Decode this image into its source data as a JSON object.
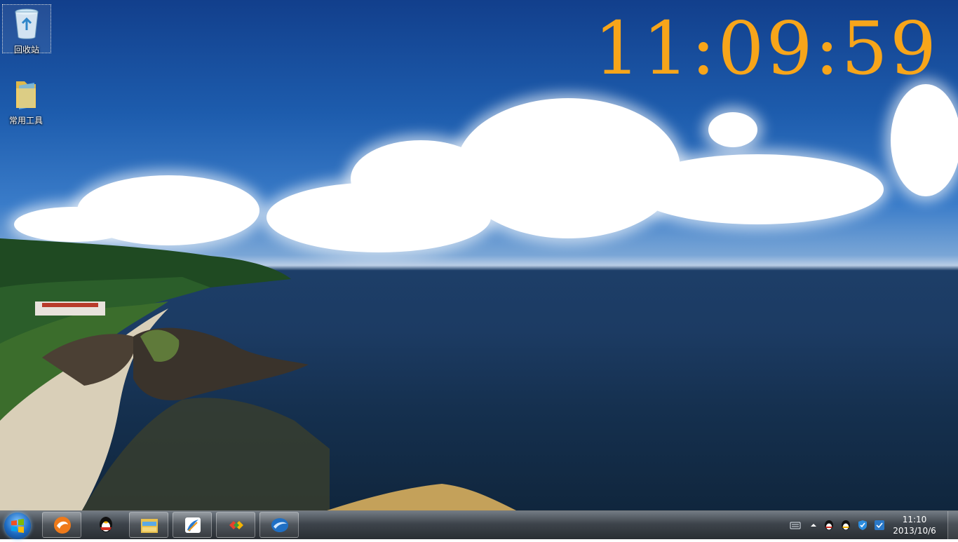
{
  "desktop": {
    "clock": "11:09:59",
    "icons": [
      {
        "label": "回收站",
        "icon": "recycle-bin-icon"
      },
      {
        "label": "常用工具",
        "icon": "folder-icon"
      }
    ]
  },
  "taskbar": {
    "start_icon": "windows-logo-icon",
    "pinned": [
      {
        "icon": "orange-browser-icon"
      },
      {
        "icon": "qq-penguin-icon"
      },
      {
        "icon": "file-explorer-icon"
      },
      {
        "icon": "blue-app-icon"
      },
      {
        "icon": "puzzle-app-icon"
      },
      {
        "icon": "blue-swoosh-app-icon"
      }
    ],
    "tray": {
      "icons": [
        "keyboard-icon",
        "show-hidden-icons-arrow",
        "qq-tray-icon",
        "qq-tray-icon-2",
        "security-shield-icon",
        "network-status-icon"
      ],
      "time": "11:10",
      "date": "2013/10/6"
    }
  },
  "colors": {
    "clock": "#f7a51a"
  }
}
